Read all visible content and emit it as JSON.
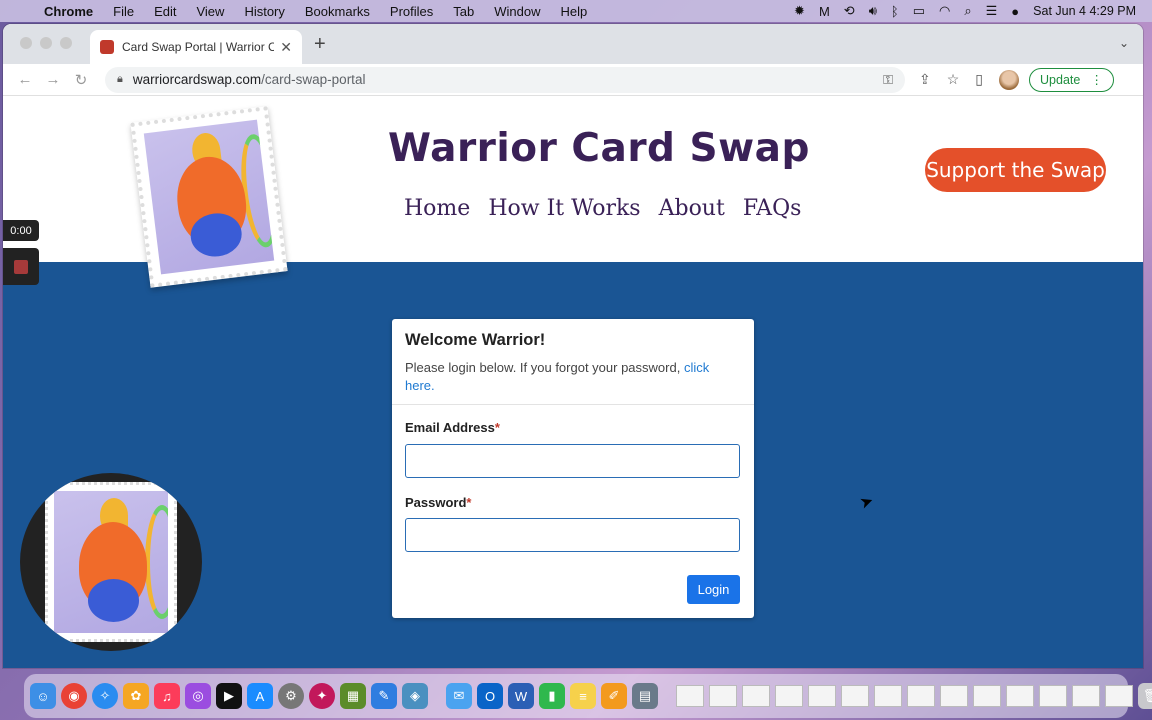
{
  "menubar": {
    "app": "Chrome",
    "items": [
      "File",
      "Edit",
      "View",
      "History",
      "Bookmarks",
      "Profiles",
      "Tab",
      "Window",
      "Help"
    ],
    "datetime": "Sat Jun 4  4:29 PM"
  },
  "browser": {
    "tab_title": "Card Swap Portal | Warrior Card Swap",
    "url_domain": "warriorcardswap.com",
    "url_path": "/card-swap-portal",
    "update_label": "Update"
  },
  "site": {
    "title": "Warrior Card Swap",
    "nav": [
      "Home",
      "How It Works",
      "About",
      "FAQs"
    ],
    "support_label": "Support the Swap"
  },
  "recording": {
    "time": "0:00"
  },
  "login": {
    "heading": "Welcome Warrior!",
    "subtext": "Please login below. If you forgot your password, ",
    "link": "click here.",
    "email_label": "Email Address",
    "password_label": "Password",
    "required_mark": "*",
    "email_value": "",
    "password_value": "",
    "button": "Login"
  },
  "colors": {
    "brand_purple": "#3a2157",
    "accent_orange": "#e4502a",
    "page_blue": "#1a5594",
    "button_blue": "#1a73e8"
  }
}
